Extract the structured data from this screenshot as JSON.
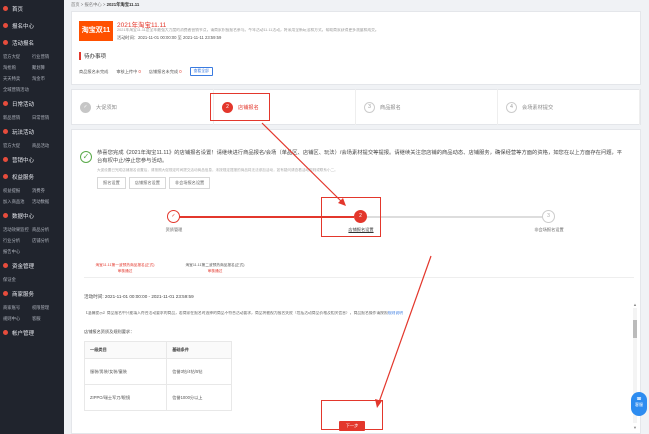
{
  "sidebar": {
    "groups": [
      {
        "label": "首页",
        "items": []
      },
      {
        "label": "报名中心",
        "items": []
      },
      {
        "label": "活动报名",
        "items": [
          "官方大促",
          "行业营销",
          "淘抢购",
          "聚划算",
          "天天特卖",
          "淘金币"
        ]
      },
      {
        "label": "全域营销活动",
        "items": [],
        "plain": true
      },
      {
        "label": "日常活动",
        "items": [
          "新品营销",
          "日常营销"
        ]
      },
      {
        "label": "玩法活动",
        "items": [
          "官方大促",
          "商品活动"
        ]
      },
      {
        "label": "营销中心",
        "items": []
      },
      {
        "label": "权益服务",
        "items": [
          "权益提报",
          "消费券",
          "加入商品池",
          "活动数据"
        ]
      },
      {
        "label": "数据中心",
        "items": [
          "活动效果监控",
          "商品分析",
          "行业分析",
          "店铺分析",
          "报告中心"
        ]
      },
      {
        "label": "资金管理",
        "items": [
          "保证金"
        ]
      },
      {
        "label": "商家服务",
        "items": [
          "商家账号",
          "权限管理",
          "规则中心",
          "客服"
        ]
      },
      {
        "label": "帐户管理",
        "items": []
      }
    ]
  },
  "breadcrumb": {
    "path": "首页 > 报名中心 > ",
    "current": "2021年淘宝11.11"
  },
  "activity": {
    "logo": "淘宝双11",
    "title": "2021年淘宝11.11",
    "desc": "2021年淘宝11.11是全年最强大力度的消费者营销节点，请商家积极报名参与。今年活动11.11活动，将采用全新玩法和方式，帮助商家获得更多流量和成交。",
    "period": "活动时间：2021-11-01 00:00:00 至 2021-11-11 23:59:59"
  },
  "todo": {
    "title": "待办事项",
    "items": [
      {
        "label": "商品报名未完成",
        "count": "",
        "tag": ""
      },
      {
        "label": "审核上传中",
        "count": "0",
        "tag": ""
      },
      {
        "label": "店铺报名未完成",
        "count": "0",
        "tag": ""
      }
    ],
    "btn": "查看全部"
  },
  "steps": [
    {
      "label": "大促须知",
      "icon": "✓",
      "state": "done"
    },
    {
      "label": "店铺报名",
      "icon": "2",
      "state": "active"
    },
    {
      "label": "商品报名",
      "icon": "3",
      "state": "todo"
    },
    {
      "label": "会场素材提交",
      "icon": "4",
      "state": "todo"
    }
  ],
  "notice": {
    "title": "恭喜您完成《2021年淘宝11.11》的店铺报名设置！请继续进行商品报名/会场（单品区、店铺区、玩法）/会场素材提交等提报。请继续关注您店铺的商品动态、店铺服务，确保经营等方面的资格，如您在以上方面存在问题，平台有权中止/停止您参与活动。",
    "sub": "大促设置已完成店铺报名设置后，请按照大促规定时间提交活动商品信息，未按规定提报的商品将无法参加活动，如有疑问请查看活动规则或联系小二。",
    "buttons": [
      "报名设置",
      "店铺报名设置",
      "非会场报名设置"
    ]
  },
  "progress": {
    "nodes": [
      {
        "num": "✓",
        "label": "资质管理"
      },
      {
        "num": "2",
        "label": "店铺报名设置"
      },
      {
        "num": "3",
        "label": "非会场报名设置"
      }
    ]
  },
  "subtabs": [
    {
      "label": "淘宝11.11第一波预热商品报名(正式)",
      "status": "审核通过"
    },
    {
      "label": "淘宝11.11第二波预热商品报名(正式)",
      "status": "审核通过"
    }
  ],
  "period_line": "活动时间: 2021-11-01 00:00:00 - 2021-11-01 23:59:59",
  "tip": {
    "text": "【温馨提示】商品报名中只能填入符合活动要求的商品，若商家在报名时选择的商品不符合活动要求，商品将被视为报名失败（包括活动商品价格及相关信息），商品报名操作请按照",
    "link": "规则说明"
  },
  "rules_head": "店铺报名资质及规则要求：",
  "rule_table": {
    "headers": [
      "一级类目",
      "基础条件"
    ],
    "rows": [
      [
        "服装/男装/女装/童装",
        "信誉3钻/4钻/5钻"
      ],
      [
        "ZIPPO/瑞士军刀/眼镜",
        "信誉1000分以上"
      ]
    ]
  },
  "next_btn": "下一步",
  "float_btn": "客服"
}
